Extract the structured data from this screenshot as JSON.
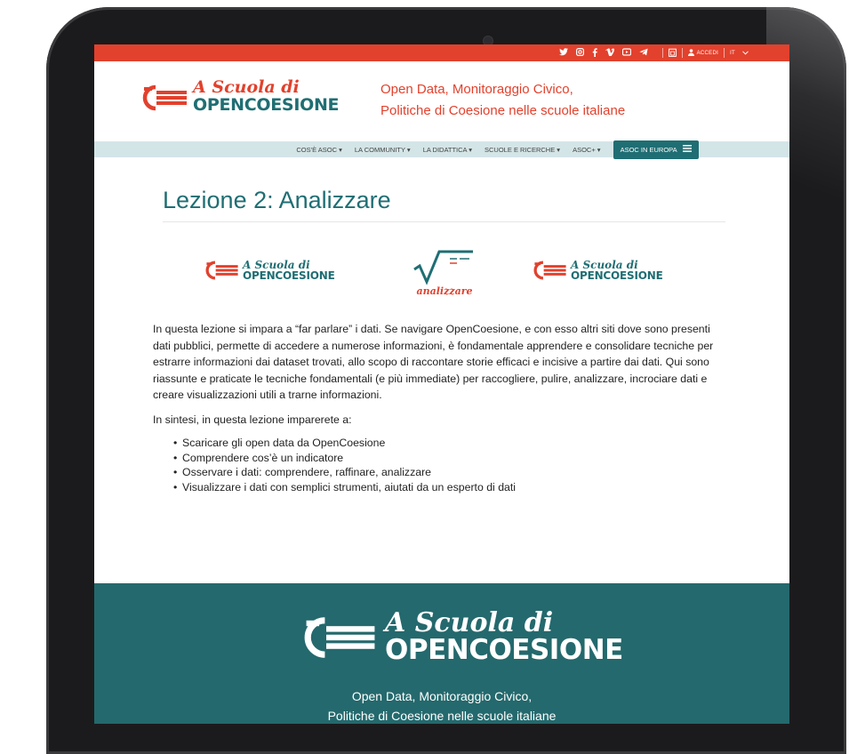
{
  "topbar": {
    "social_icons": [
      "twitter-icon",
      "instagram-icon",
      "facebook-icon",
      "vimeo-icon",
      "youtube-icon",
      "telegram-icon",
      "calendar-icon"
    ],
    "login_label": "ACCEDI",
    "language": "IT"
  },
  "header": {
    "logo_script": "A Scuola di",
    "logo_caps": "OPENCOESIONE",
    "tagline_line1": "Open Data, Monitoraggio Civico,",
    "tagline_line2": "Politiche di Coesione nelle scuole italiane"
  },
  "nav": {
    "items": [
      {
        "label": "COS'È ASOC",
        "caret": "▾"
      },
      {
        "label": "LA COMMUNITY",
        "caret": "▾"
      },
      {
        "label": "LA DIDATTICA",
        "caret": "▾"
      },
      {
        "label": "SCUOLE E RICERCHE",
        "caret": "▾"
      },
      {
        "label": "ASOC+",
        "caret": "▾"
      }
    ],
    "cta_label": "ASOC IN EUROPA"
  },
  "main": {
    "title": "Lezione 2: Analizzare",
    "logos": {
      "script": "A Scuola di",
      "caps": "OPENCOESIONE",
      "center_label": "analizzare"
    },
    "paragraph1": "In questa lezione si impara a “far parlare” i dati. Se navigare OpenCoesione, e con esso altri siti dove sono presenti dati pubblici, permette di accedere a numerose informazioni, è fondamentale apprendere e consolidare tecniche per estrarre informazioni dai dataset trovati, allo scopo di raccontare storie efficaci e incisive a partire dai dati. Qui sono riassunte e praticate le tecniche fondamentali (e più immediate) per raccogliere, pulire, analizzare, incrociare dati e creare visualizzazioni utili a trarne informazioni.",
    "paragraph2": "In sintesi, in questa lezione imparerete a:",
    "bullets": [
      "Scaricare gli open data da OpenCoesione",
      "Comprendere cos’è un indicatore",
      "Osservare i dati: comprendere, raffinare, analizzare",
      "Visualizzare i dati con semplici strumenti, aiutati da un esperto di dati"
    ]
  },
  "footer": {
    "logo_script": "A Scuola di",
    "logo_caps": "OPENCOESIONE",
    "tagline_line1": "Open Data, Monitoraggio Civico,",
    "tagline_line2": "Politiche di Coesione nelle scuole italiane"
  },
  "colors": {
    "accent_red": "#e2412d",
    "teal": "#1f6e73",
    "footer_teal": "#24696d",
    "nav_bg": "#d4e5e7"
  }
}
